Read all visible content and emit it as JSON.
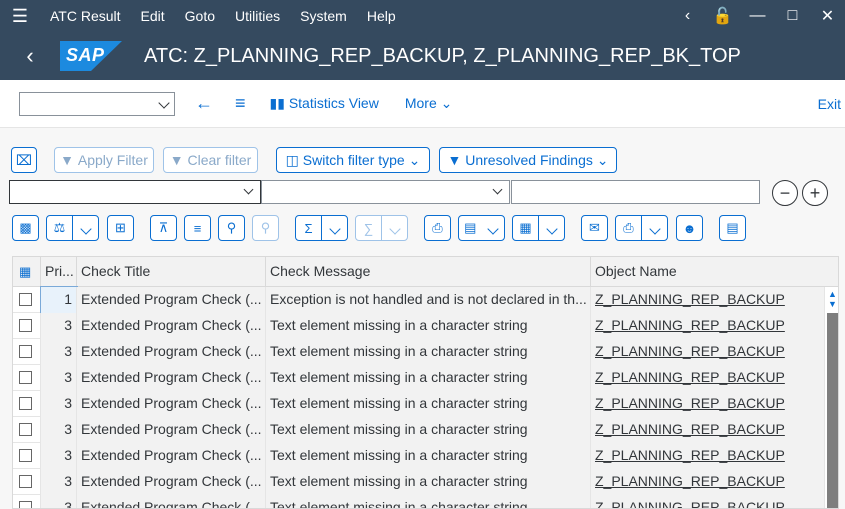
{
  "menubar": {
    "items": [
      "ATC Result",
      "Edit",
      "Goto",
      "Utilities",
      "System",
      "Help"
    ]
  },
  "titlebar": {
    "logo_text": "SAP",
    "title": "ATC:  Z_PLANNING_REP_BACKUP, Z_PLANNING_REP_BK_TOP"
  },
  "appbar": {
    "statistics_view": "Statistics View",
    "more": "More",
    "exit": "Exit"
  },
  "filterbar": {
    "apply_filter": "Apply Filter",
    "clear_filter": "Clear filter",
    "switch_filter_type": "Switch filter type",
    "unresolved_findings": "Unresolved Findings"
  },
  "table": {
    "columns": [
      "Pri...",
      "Check Title",
      "Check Message",
      "Object Name"
    ],
    "rows": [
      {
        "priority": "1",
        "title": "Extended Program Check (...",
        "message": "Exception is not handled and is not declared in th...",
        "object": "Z_PLANNING_REP_BACKUP"
      },
      {
        "priority": "3",
        "title": "Extended Program Check (...",
        "message": "Text element missing in a character string",
        "object": "Z_PLANNING_REP_BACKUP"
      },
      {
        "priority": "3",
        "title": "Extended Program Check (...",
        "message": "Text element missing in a character string",
        "object": "Z_PLANNING_REP_BACKUP"
      },
      {
        "priority": "3",
        "title": "Extended Program Check (...",
        "message": "Text element missing in a character string",
        "object": "Z_PLANNING_REP_BACKUP"
      },
      {
        "priority": "3",
        "title": "Extended Program Check (...",
        "message": "Text element missing in a character string",
        "object": "Z_PLANNING_REP_BACKUP"
      },
      {
        "priority": "3",
        "title": "Extended Program Check (...",
        "message": "Text element missing in a character string",
        "object": "Z_PLANNING_REP_BACKUP"
      },
      {
        "priority": "3",
        "title": "Extended Program Check (...",
        "message": "Text element missing in a character string",
        "object": "Z_PLANNING_REP_BACKUP"
      },
      {
        "priority": "3",
        "title": "Extended Program Check (...",
        "message": "Text element missing in a character string",
        "object": "Z_PLANNING_REP_BACKUP"
      },
      {
        "priority": "3",
        "title": "Extended Program Check (...",
        "message": "Text element missing in a character string",
        "object": "Z_PLANNING_REP_BACKUP"
      }
    ]
  },
  "colors": {
    "shell": "#354a5f",
    "accent": "#0a6ed1",
    "sap_blue": "#1c8adf"
  }
}
